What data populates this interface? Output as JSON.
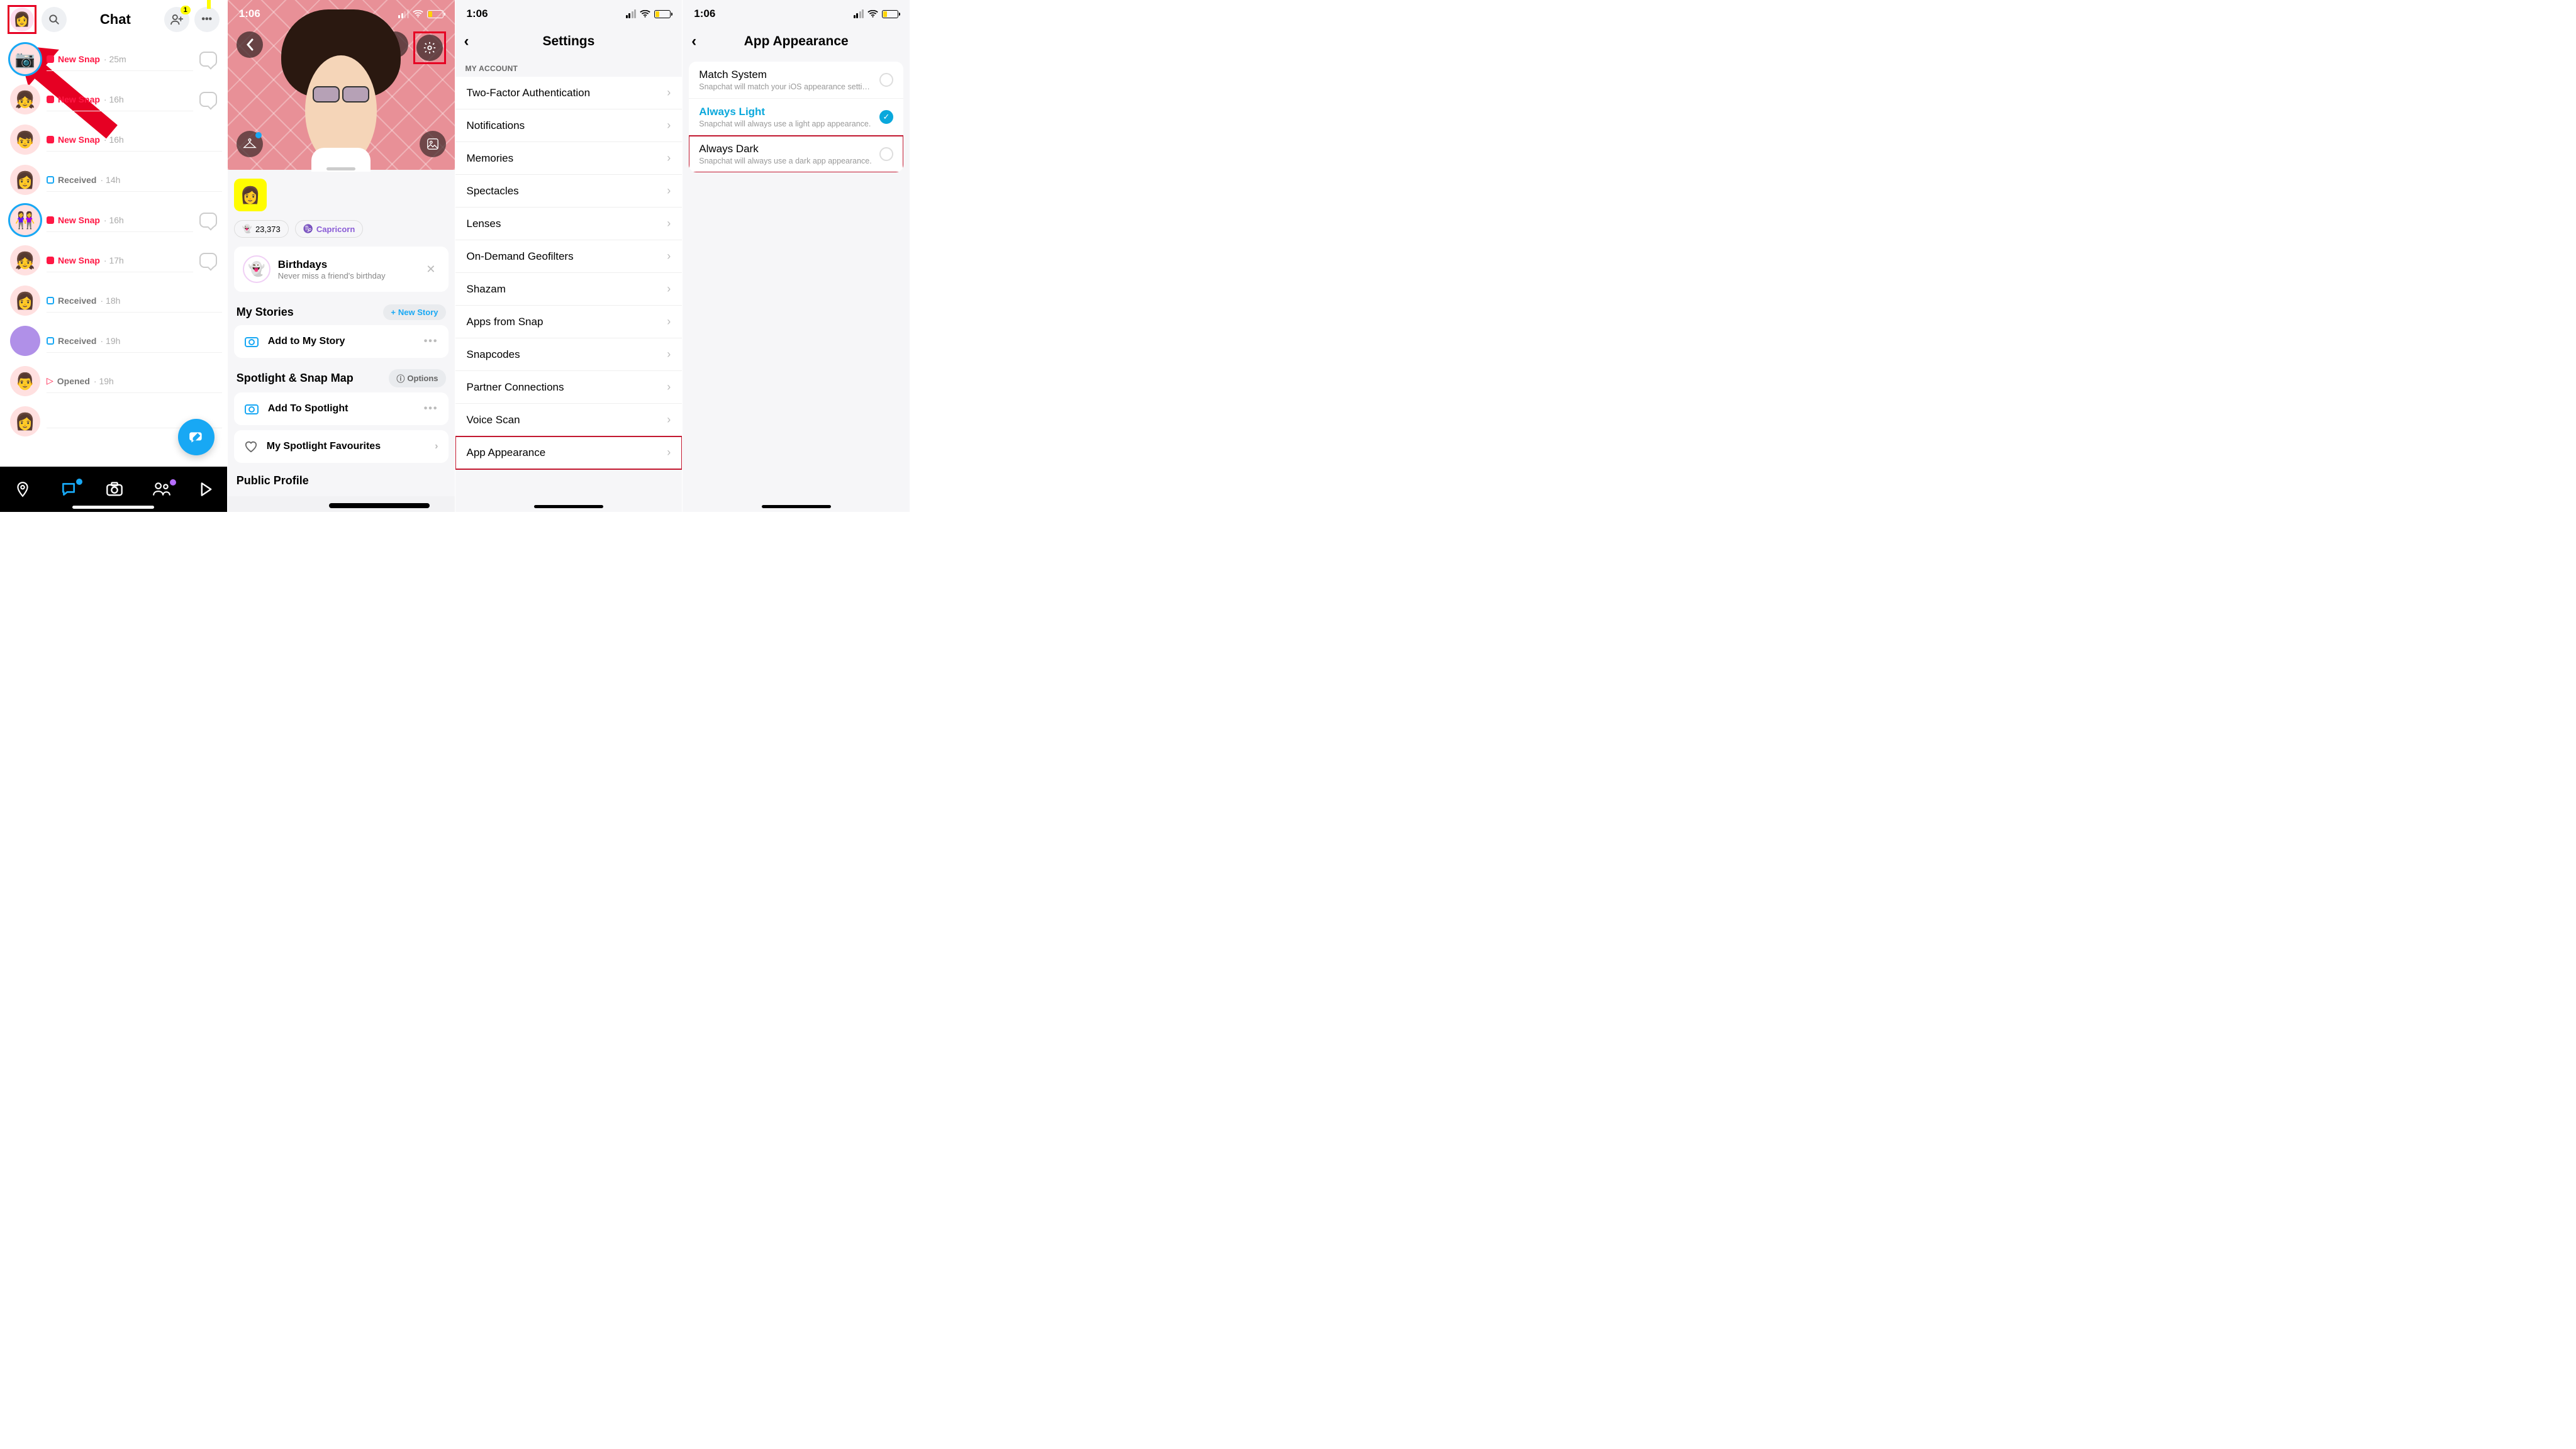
{
  "phone1": {
    "title": "Chat",
    "addfriend_badge": "1",
    "chats": [
      {
        "status": "New Snap",
        "time": "25m",
        "type": "red",
        "ring": true,
        "bubble": true,
        "emoji": "📷"
      },
      {
        "status": "New Snap",
        "time": "16h",
        "type": "red",
        "bubble": true,
        "emoji": "👧"
      },
      {
        "status": "New Snap",
        "time": "16h",
        "type": "red",
        "bubble": false,
        "emoji": "👦"
      },
      {
        "status": "Received",
        "time": "14h",
        "type": "blue",
        "bubble": false,
        "emoji": "👩"
      },
      {
        "status": "New Snap",
        "time": "16h",
        "type": "red",
        "ring": true,
        "bubble": true,
        "emoji": "👭"
      },
      {
        "status": "New Snap",
        "time": "17h",
        "type": "red",
        "bubble": true,
        "emoji": "👧"
      },
      {
        "status": "Received",
        "time": "18h",
        "type": "blue",
        "bubble": false,
        "emoji": "👩"
      },
      {
        "status": "Received",
        "time": "19h",
        "type": "blue",
        "silh": true,
        "bubble": false,
        "emoji": ""
      },
      {
        "status": "Opened",
        "time": "19h",
        "type": "opened",
        "bubble": false,
        "emoji": "👨"
      },
      {
        "status": "",
        "time": "",
        "type": "",
        "bubble": false,
        "emoji": "👩"
      }
    ]
  },
  "phone2": {
    "time": "1:06",
    "score": "23,373",
    "zodiac": "Capricorn",
    "birthdays_title": "Birthdays",
    "birthdays_sub": "Never miss a friend's birthday",
    "stories_title": "My Stories",
    "newstory": "New Story",
    "add_story": "Add to My Story",
    "spotlight_title": "Spotlight & Snap Map",
    "options": "Options",
    "add_spotlight": "Add To Spotlight",
    "fav_spotlight": "My Spotlight Favourites",
    "public_profile": "Public Profile"
  },
  "phone3": {
    "time": "1:06",
    "title": "Settings",
    "section": "MY ACCOUNT",
    "items": [
      "Two-Factor Authentication",
      "Notifications",
      "Memories",
      "Spectacles",
      "Lenses",
      "On-Demand Geofilters",
      "Shazam",
      "Apps from Snap",
      "Snapcodes",
      "Partner Connections",
      "Voice Scan",
      "App Appearance"
    ]
  },
  "phone4": {
    "time": "1:06",
    "title": "App Appearance",
    "opts": [
      {
        "title": "Match System",
        "sub": "Snapchat will match your iOS appearance setti…",
        "active": false
      },
      {
        "title": "Always Light",
        "sub": "Snapchat will always use a light app appearance.",
        "active": true
      },
      {
        "title": "Always Dark",
        "sub": "Snapchat will always use a dark app appearance.",
        "active": false,
        "hl": true
      }
    ]
  }
}
